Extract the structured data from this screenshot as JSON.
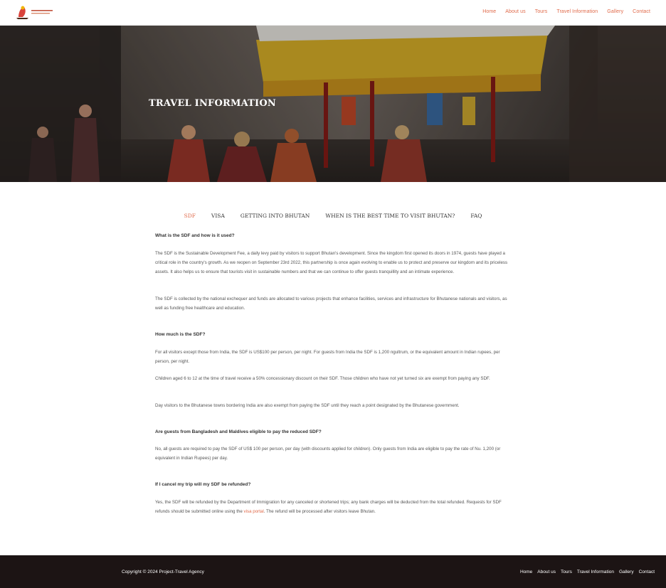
{
  "header": {
    "nav": [
      "Home",
      "About us",
      "Tours",
      "Travel Information",
      "Gallery",
      "Contact"
    ]
  },
  "hero": {
    "title": "TRAVEL INFORMATION"
  },
  "tabs": [
    {
      "label": "SDF",
      "active": true
    },
    {
      "label": "VISA",
      "active": false
    },
    {
      "label": "GETTING INTO BHUTAN",
      "active": false
    },
    {
      "label": "WHEN IS THE BEST TIME TO VISIT BHUTAN?",
      "active": false
    },
    {
      "label": "FAQ",
      "active": false
    }
  ],
  "content": {
    "q1": "What is the SDF and how is it used?",
    "p1": "The SDF is the Sustainable Development Fee, a daily levy paid by visitors to support Bhutan's development. Since the kingdom first opened its doors in 1974, guests have played a critical role in the country's growth. As we reopen on September 23rd 2022, this partnership is once again evolving to enable us to protect and preserve our kingdom and its priceless assets. It also helps us to ensure that tourists visit in sustainable numbers and that we can continue to offer guests tranquillity and an intimate experience.",
    "p2": "The SDF is collected by the national exchequer and funds are allocated to various projects that enhance facilities, services and infrastructure for Bhutanese nationals and visitors, as well as funding free healthcare and education.",
    "q2": "How much is the SDF?",
    "p3": "For all visitors except those from India, the SDF is US$100 per person, per night. For guests from India the SDF is 1,200 ngultrum, or the equivalent amount in Indian rupees, per person, per night.",
    "p4": "Children aged 6 to 12 at the time of travel receive a 50% concessionary discount on their SDF. Those children who have not yet turned six are exempt from paying any SDF.",
    "p5": "Day visitors to the Bhutanese towns bordering India are also exempt from paying the SDF until they reach a point designated by the Bhutanese government.",
    "q3": "Are guests from Bangladesh and Maldives eligible to pay the reduced SDF?",
    "p6": "No, all guests are required to pay the SDF of US$ 100 per person, per day (with discounts applied for children). Only guests from India are eligible to pay the rate of Nu. 1,200 (or equivalent in Indian Rupees) per day.",
    "q4": "If I cancel my trip will my SDF be refunded?",
    "p7_before": "Yes, the SDF will be refunded by the Department of Immigration for any canceled or shortened trips; any bank charges will be deducted from the total refunded. Requests for SDF refunds should be submitted online using the ",
    "p7_link": "visa portal",
    "p7_after": ". The refund will be processed after visitors leave Bhutan."
  },
  "footer": {
    "copyright": "Copyright © 2024 Project-Travel Agency",
    "nav": [
      "Home",
      "About us",
      "Tours",
      "Travel Information",
      "Gallery",
      "Contact"
    ]
  },
  "colors": {
    "accent": "#e06a4a",
    "footer_bg": "#1c1414"
  }
}
